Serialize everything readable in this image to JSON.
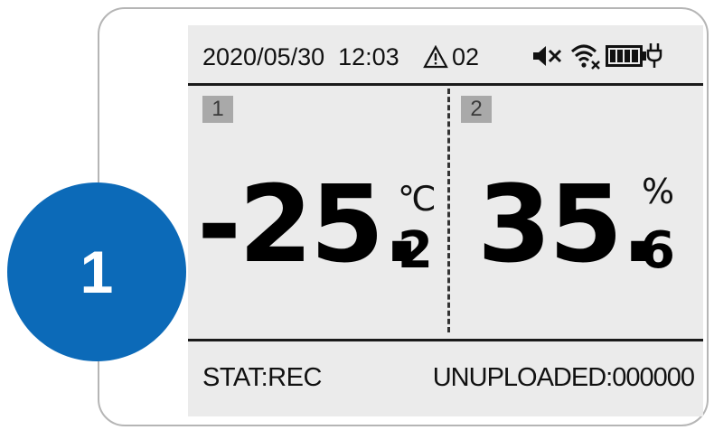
{
  "status_bar": {
    "datetime": "2020/05/30  12:03",
    "alarm_count": "02",
    "icons": [
      "warning-triangle-icon",
      "mute-icon",
      "wifi-off-icon",
      "battery-full-icon",
      "plug-icon"
    ]
  },
  "channels": [
    {
      "number": "1",
      "integer": "-25.",
      "decimal": "2",
      "unit": "℃"
    },
    {
      "number": "2",
      "integer": "35.",
      "decimal": "6",
      "unit": "%"
    }
  ],
  "footer": {
    "stat": "STAT:REC",
    "unuploaded": "UNUPLOADED:000000"
  },
  "callout": {
    "label": "1"
  },
  "colors": {
    "callout_fill": "#0c6ab8",
    "screen_background": "#ebebeb",
    "channel_badge": "#a9a9a9",
    "device_border": "#b5b5b5"
  }
}
